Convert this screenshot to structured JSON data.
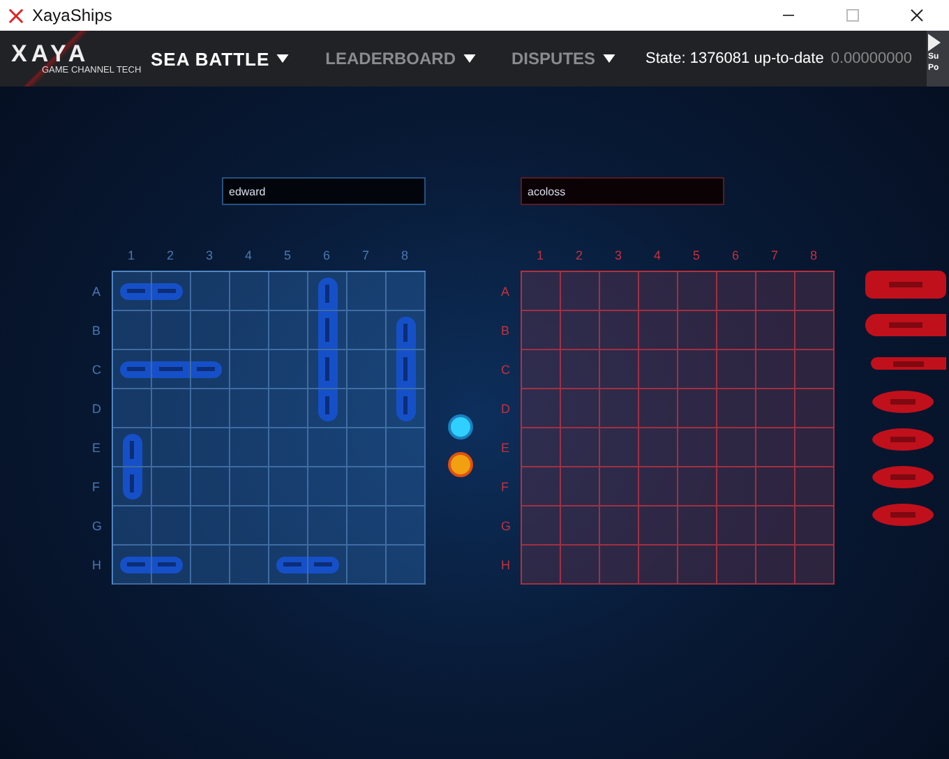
{
  "window": {
    "title": "XayaShips"
  },
  "nav": {
    "logo_text": "XAYA",
    "logo_subtitle": "GAME CHANNEL TECH",
    "items": [
      {
        "label": "SEA BATTLE",
        "selected": true
      },
      {
        "label": "LEADERBOARD",
        "selected": false
      },
      {
        "label": "DISPUTES",
        "selected": false
      }
    ],
    "state": "State: 1376081 up-to-date",
    "balance": "0.00000000",
    "cut_button": [
      "Su",
      "Po"
    ]
  },
  "boards": [
    {
      "opponent": false,
      "player": "edward",
      "columns": [
        "1",
        "2",
        "3",
        "4",
        "5",
        "6",
        "7",
        "8"
      ],
      "rows": [
        {
          "label": "A",
          "occupied": [
            true,
            true,
            false,
            false,
            false,
            true,
            false,
            false
          ]
        },
        {
          "label": "B",
          "occupied": [
            false,
            false,
            false,
            false,
            false,
            true,
            false,
            true
          ]
        },
        {
          "label": "C",
          "occupied": [
            true,
            true,
            true,
            false,
            false,
            true,
            false,
            true
          ]
        },
        {
          "label": "D",
          "occupied": [
            false,
            false,
            false,
            false,
            false,
            true,
            false,
            true
          ]
        },
        {
          "label": "E",
          "occupied": [
            true,
            false,
            false,
            false,
            false,
            false,
            false,
            false
          ]
        },
        {
          "label": "F",
          "occupied": [
            true,
            false,
            false,
            false,
            false,
            false,
            false,
            false
          ]
        },
        {
          "label": "G",
          "occupied": [
            false,
            false,
            false,
            false,
            false,
            false,
            false,
            false
          ]
        },
        {
          "label": "H",
          "occupied": [
            true,
            true,
            false,
            false,
            true,
            true,
            false,
            false
          ]
        }
      ]
    },
    {
      "opponent": true,
      "player": "acoloss",
      "columns": [
        "1",
        "2",
        "3",
        "4",
        "5",
        "6",
        "7",
        "8"
      ],
      "rows": [
        {
          "label": "A"
        },
        {
          "label": "B"
        },
        {
          "label": "C"
        },
        {
          "label": "D"
        },
        {
          "label": "E"
        },
        {
          "label": "F"
        },
        {
          "label": "G"
        },
        {
          "label": "H"
        }
      ]
    }
  ],
  "turn_markers": [
    {
      "kind": "own"
    },
    {
      "kind": "enemy"
    }
  ],
  "enemy_fleet": [
    {
      "kind": "carrier"
    },
    {
      "kind": "cruiser"
    },
    {
      "kind": "sub"
    },
    {
      "kind": "boat"
    },
    {
      "kind": "boat"
    },
    {
      "kind": "boat"
    },
    {
      "kind": "boat"
    }
  ]
}
